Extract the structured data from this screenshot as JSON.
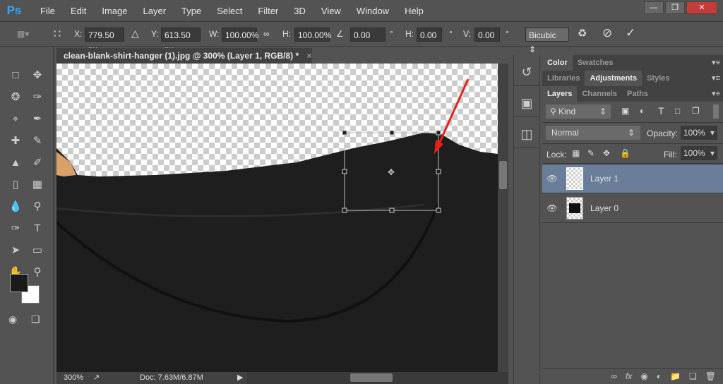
{
  "app": {
    "logo": "Ps",
    "menu": [
      "File",
      "Edit",
      "Image",
      "Layer",
      "Type",
      "Select",
      "Filter",
      "3D",
      "View",
      "Window",
      "Help"
    ],
    "window_buttons": [
      "minimize",
      "restore",
      "close"
    ]
  },
  "options": {
    "x_label": "X:",
    "x": "779.50 px",
    "y_label": "Y:",
    "y": "613.50 px",
    "w_label": "W:",
    "w": "100.00%",
    "h_label": "H:",
    "h": "100.00%",
    "angle": "0.00",
    "deg": "°",
    "hskew_label": "H:",
    "hskew": "0.00",
    "vskew_label": "V:",
    "vskew": "0.00",
    "interp": "Bicubic"
  },
  "document": {
    "tab_title": "clean-blank-shirt-hanger (1).jpg @ 300% (Layer 1, RGB/8) *",
    "close": "×",
    "zoom": "300%",
    "doc_info": "Doc: 7.63M/6.87M"
  },
  "panels": {
    "row1": [
      "Color",
      "Swatches"
    ],
    "row2": [
      "Libraries",
      "Adjustments",
      "Styles"
    ],
    "row3": [
      "Layers",
      "Channels",
      "Paths"
    ],
    "filter_kind": "Kind",
    "blend_mode": "Normal",
    "opacity_label": "Opacity:",
    "opacity": "100%",
    "lock_label": "Lock:",
    "fill_label": "Fill:",
    "fill": "100%",
    "layers": [
      {
        "name": "Layer 1",
        "selected": true
      },
      {
        "name": "Layer 0",
        "selected": false
      }
    ],
    "footer_icons": [
      "link-icon",
      "fx-icon",
      "mask-icon",
      "adjustment-icon",
      "folder-icon",
      "new-layer-icon",
      "trash-icon"
    ]
  },
  "colors": {
    "accent": "#6b7e99",
    "arrow": "#e8201a",
    "foreground": "#1a1a1a",
    "background": "#ffffff"
  }
}
